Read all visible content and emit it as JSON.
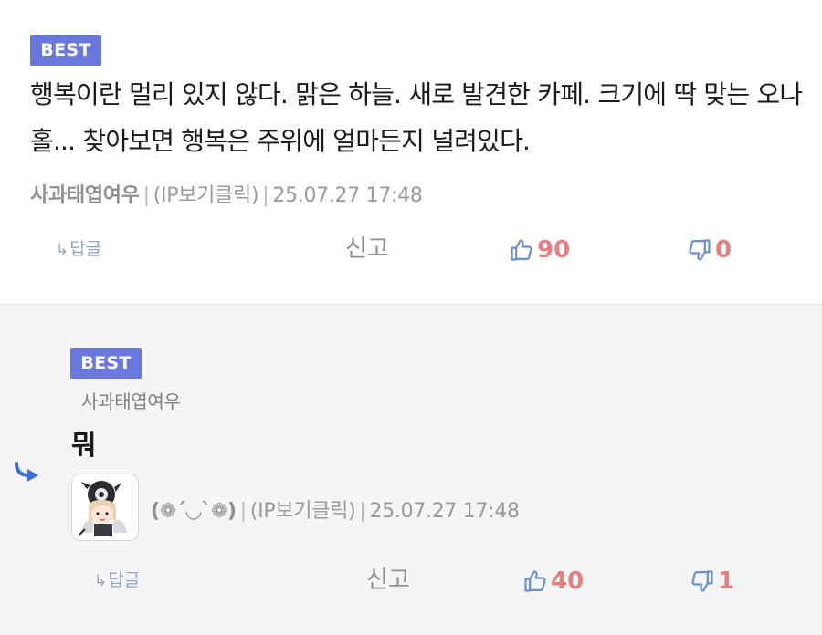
{
  "main_comment": {
    "badge": "BEST",
    "text": "행복이란 멀리 있지 않다. 맑은 하늘. 새로 발견한 카페. 크기에 딱 맞는 오나홀... 찾아보면 행복은 주위에 얼마든지 널려있다.",
    "author": "사과태엽여우",
    "ip_label": "(IP보기클릭)",
    "timestamp": "25.07.27 17:48",
    "separator": "|",
    "actions": {
      "reply_label": "답글",
      "reply_arrow": "↳",
      "report_label": "신고",
      "like_count": "90",
      "dislike_count": "0"
    }
  },
  "reply_comment": {
    "badge": "BEST",
    "reply_to": "사과태엽여우",
    "text": "뭐",
    "nickname": "(❁´◡`❁)",
    "ip_label": "(IP보기클릭)",
    "timestamp": "25.07.27 17:48",
    "separator": "|",
    "actions": {
      "reply_label": "답글",
      "reply_arrow": "↳",
      "report_label": "신고",
      "like_count": "40",
      "dislike_count": "1"
    }
  },
  "colors": {
    "badge": "#6878dc",
    "count": "#e57f7f",
    "icon": "#8fa3c2",
    "reply_arrow": "#3d6fcf"
  }
}
